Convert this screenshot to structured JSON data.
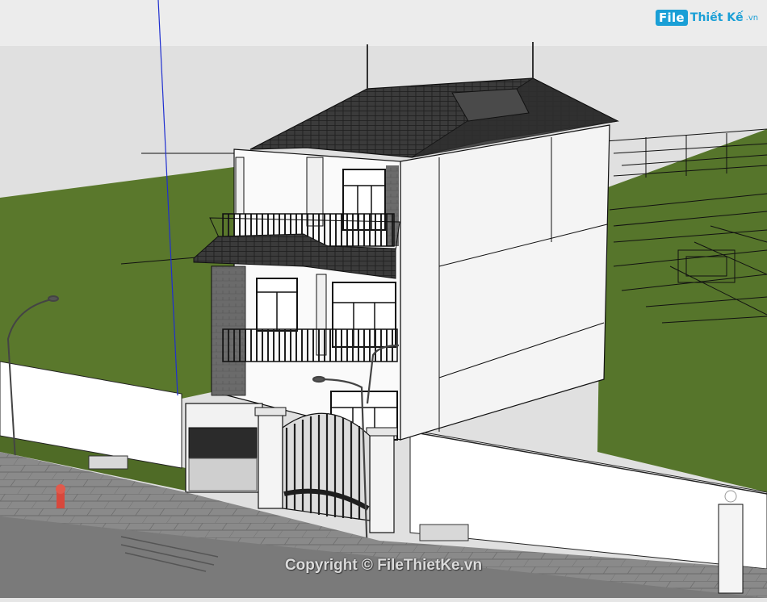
{
  "brand": {
    "logo_file": "File",
    "logo_rest": "Thiết Kế",
    "logo_domain": ".vn",
    "accent_color": "#1a9fd6"
  },
  "watermark": {
    "text": "Copyright © FileThietKe.vn"
  },
  "scene": {
    "sky_color": "#e6e6e6",
    "ground_color": "#5c7a2e",
    "wall_color": "#ffffff",
    "roof_color": "#3a3a3a",
    "axis_blue_color": "#1f2fd0"
  }
}
